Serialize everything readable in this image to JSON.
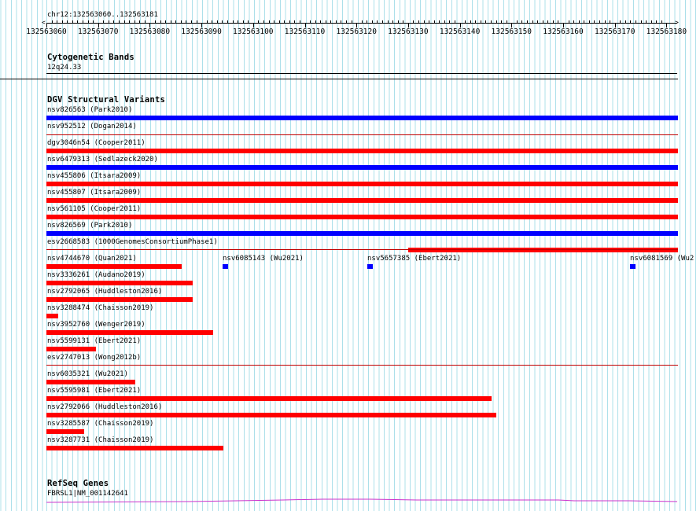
{
  "ruler": {
    "range_label": "chr12:132563060..132563181",
    "tick_labels": [
      "132563060",
      "132563070",
      "132563080",
      "132563090",
      "132563100",
      "132563110",
      "132563120",
      "132563130",
      "132563140",
      "132563150",
      "132563160",
      "132563170",
      "132563180"
    ]
  },
  "cytoband_track": {
    "title": "Cytogenetic Bands",
    "band_label": "12q24.33"
  },
  "dgv_track": {
    "title": "DGV Structural Variants",
    "colors": {
      "loss": "#ff0000",
      "gain": "#0000ff",
      "separator": "#c00000"
    },
    "full_rows": [
      {
        "label": "nsv826563 (Park2010)",
        "kind": "gain"
      },
      {
        "label": "nsv952512 (Dogan2014)",
        "kind": "none"
      },
      {
        "label": "dgv3046n54 (Cooper2011)",
        "kind": "loss"
      },
      {
        "label": "nsv6479313 (Sedlazeck2020)",
        "kind": "gain"
      },
      {
        "label": "nsv455806 (Itsara2009)",
        "kind": "loss"
      },
      {
        "label": "nsv455807 (Itsara2009)",
        "kind": "loss"
      },
      {
        "label": "nsv561105 (Cooper2011)",
        "kind": "loss"
      },
      {
        "label": "nsv826569 (Park2010)",
        "kind": "gain"
      },
      {
        "label": "esv2668583 (1000GenomesConsortiumPhase1)",
        "kind": "loss_partial"
      }
    ],
    "group1": [
      {
        "label": "nsv4744670 (Quan2021)"
      },
      {
        "label": "nsv3336261 (Audano2019)"
      },
      {
        "label": "nsv2792065 (Huddleston2016)"
      },
      {
        "label": "nsv3288474 (Chaisson2019)"
      },
      {
        "label": "nsv3952760 (Wenger2019)"
      },
      {
        "label": "nsv5599131 (Ebert2021)"
      },
      {
        "label": "esv2747013 (Wong2012b)"
      }
    ],
    "small_features": [
      {
        "label": "nsv6085143 (Wu2021)"
      },
      {
        "label": "nsv5657385 (Ebert2021)"
      },
      {
        "label": "nsv6081569 (Wu2"
      }
    ],
    "group2": [
      {
        "label": "nsv6035321 (Wu2021)"
      },
      {
        "label": "nsv5595981 (Ebert2021)"
      },
      {
        "label": "nsv2792066 (Huddleston2016)"
      },
      {
        "label": "nsv3285587 (Chaisson2019)"
      },
      {
        "label": "nsv3287731 (Chaisson2019)"
      }
    ]
  },
  "refseq_track": {
    "title": "RefSeq Genes",
    "gene_label": "FBRSL1|NM_001142641",
    "color": "#cc33cc"
  }
}
